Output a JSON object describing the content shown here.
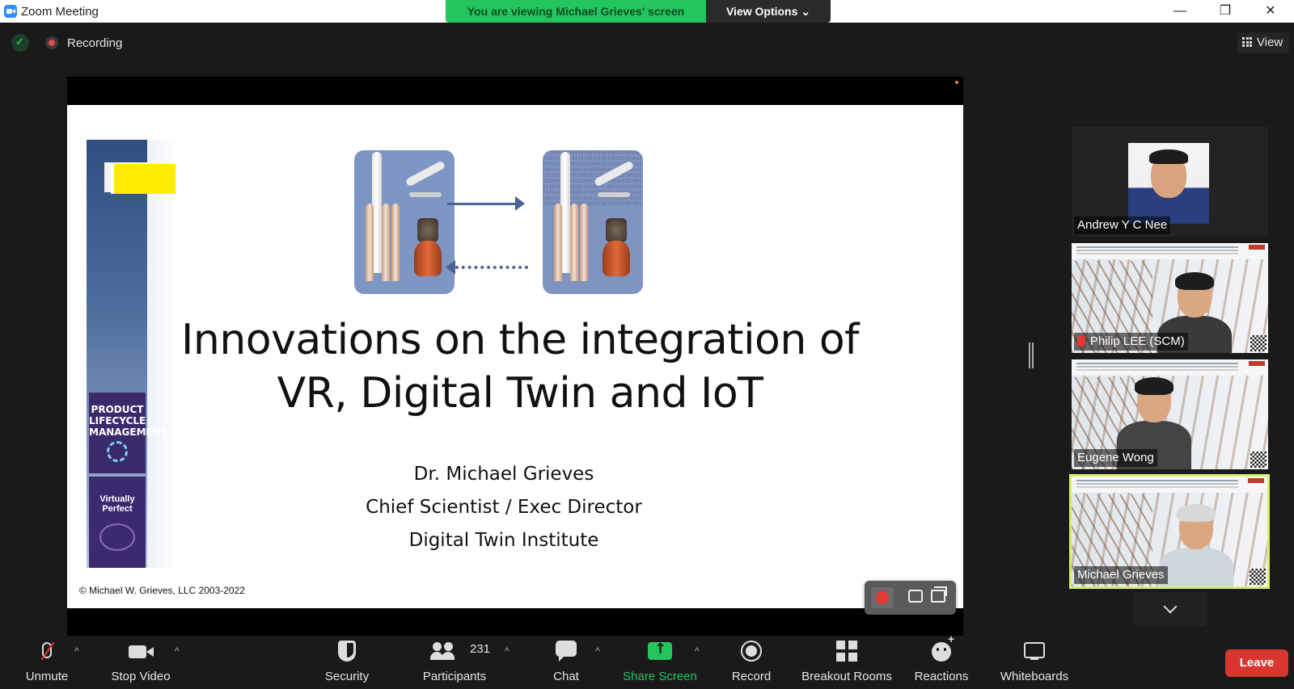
{
  "window": {
    "title": "Zoom Meeting",
    "viewing_banner": "You are viewing Michael Grieves' screen",
    "view_options": "View Options ⌄",
    "minimize": "—",
    "restore": "❐",
    "close": "✕"
  },
  "meeting": {
    "recording_label": "Recording",
    "view_label": "View"
  },
  "slide": {
    "title_line1": "Innovations on the integration of",
    "title_line2": "VR, Digital Twin and IoT",
    "author": "Dr. Michael Grieves",
    "role": "Chief Scientist / Exec Director",
    "org": "Digital Twin Institute",
    "copyright": "© Michael W. Grieves, LLC 2003-2022",
    "book1_title": "PRODUCT LIFECYCLE MANAGEMENT",
    "book2_title": "Virtually Perfect"
  },
  "participants": [
    {
      "name": "Andrew Y C Nee",
      "muted": false
    },
    {
      "name": "Philip LEE (SCM)",
      "muted": true
    },
    {
      "name": "Eugene Wong",
      "muted": false
    },
    {
      "name": "Michael Grieves",
      "muted": false,
      "active_speaker": true
    }
  ],
  "toolbar": {
    "unmute": "Unmute",
    "stop_video": "Stop Video",
    "security": "Security",
    "participants": "Participants",
    "participant_count": "231",
    "chat": "Chat",
    "share_screen": "Share Screen",
    "record": "Record",
    "breakout_rooms": "Breakout Rooms",
    "reactions": "Reactions",
    "whiteboards": "Whiteboards",
    "leave": "Leave",
    "caret": "^"
  },
  "colors": {
    "banner_green": "#22c55e",
    "leave_red": "#d9362f",
    "active_speaker_border": "#d9ef6a",
    "share_green": "#22c55e"
  }
}
